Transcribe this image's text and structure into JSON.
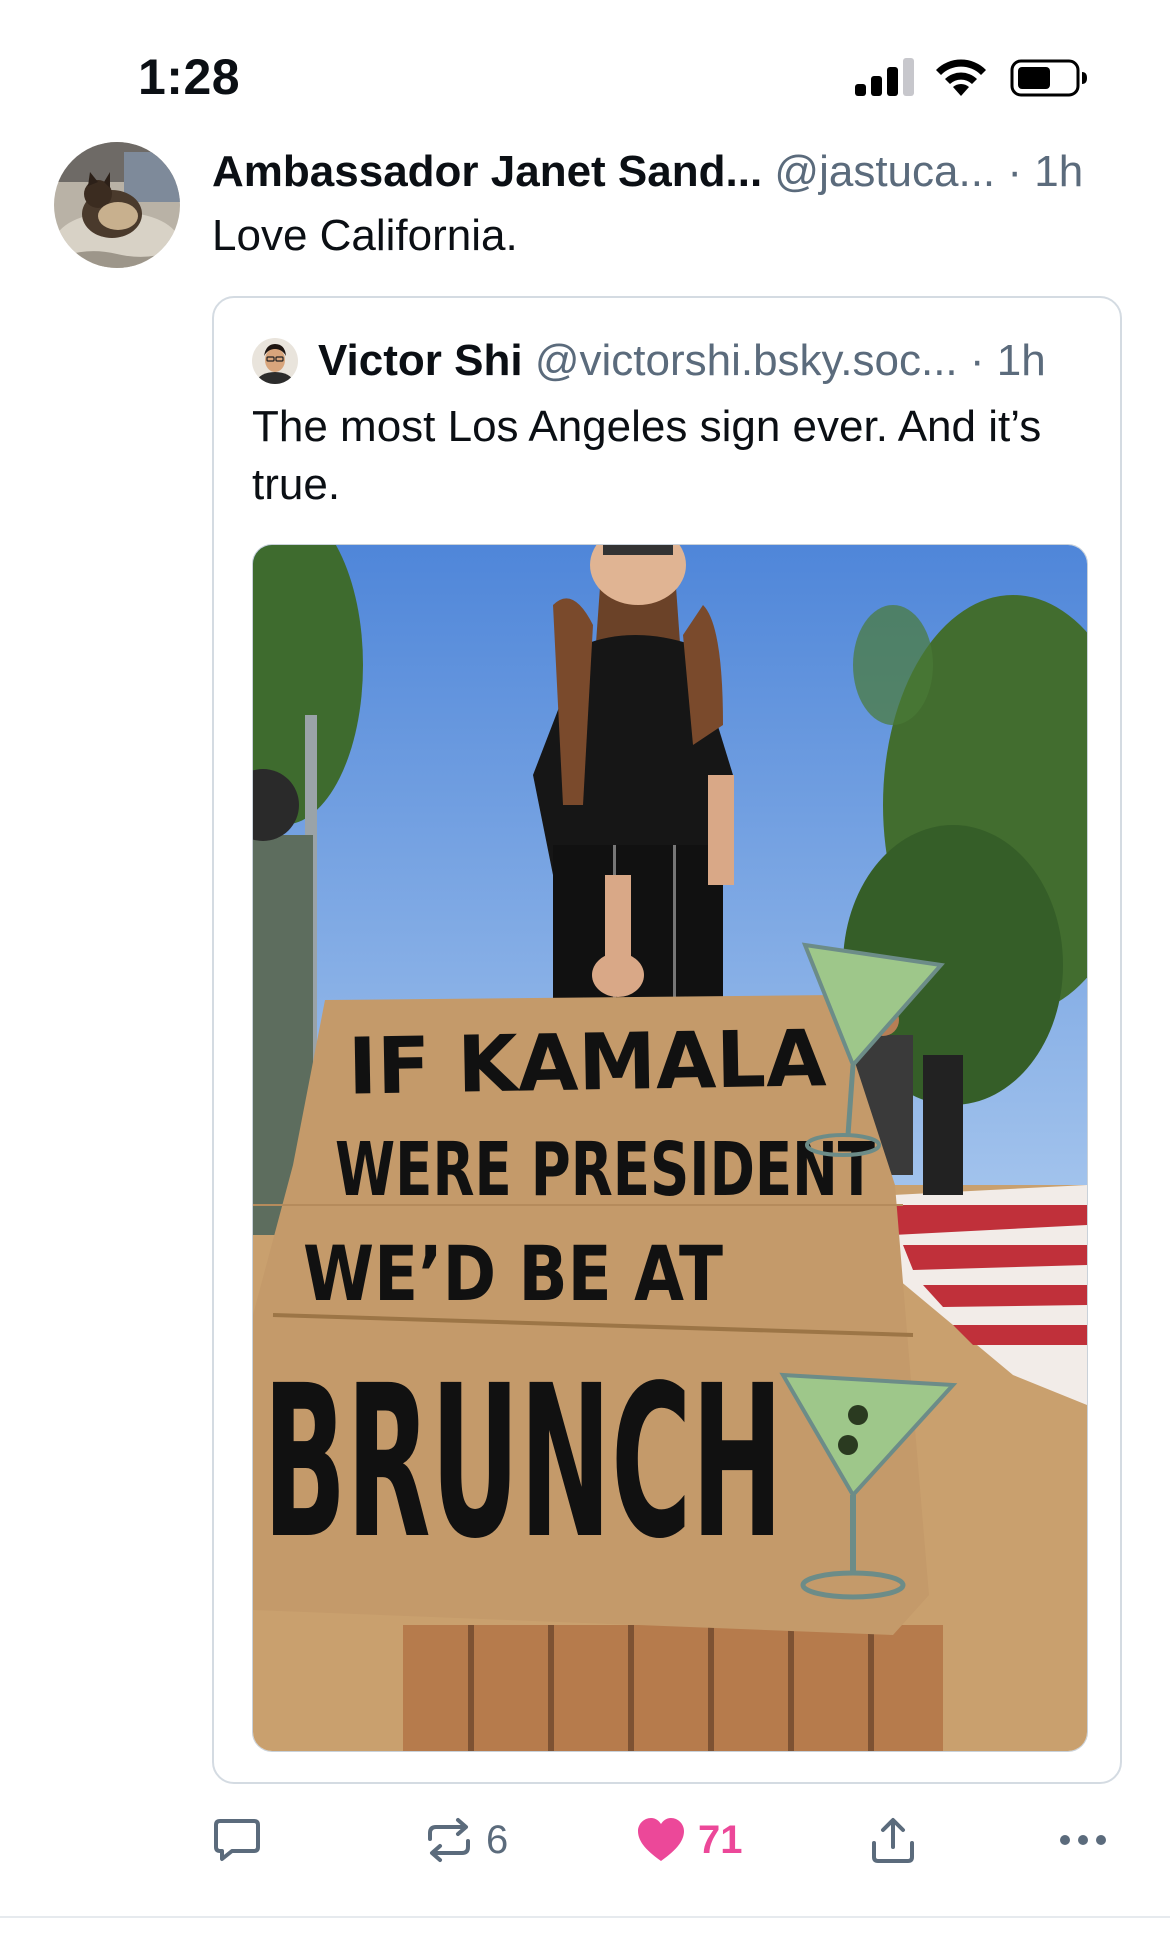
{
  "status_bar": {
    "time": "1:28"
  },
  "post": {
    "author_name": "Ambassador Janet Sand...",
    "author_handle": "@jastuca...",
    "separator": " · ",
    "time": "1h",
    "text": "Love California.",
    "avatar_icon": "cat-avatar-icon"
  },
  "quote": {
    "author_name": "Victor Shi",
    "author_handle": "@victorshi.bsky.soc...",
    "separator": " · ",
    "time": "1h",
    "text": "The most Los Angeles sign ever. And it’s true.",
    "image_sign_lines": [
      "IF KAMALA",
      "WERE PRESIDENT",
      "WE’D BE AT",
      "BRUNCH"
    ]
  },
  "actions": {
    "reply_icon": "reply-icon",
    "repost_icon": "repost-icon",
    "repost_count": "6",
    "like_icon": "heart-icon",
    "like_count": "71",
    "share_icon": "share-icon",
    "more_icon": "more-icon"
  },
  "colors": {
    "like": "#ec4899",
    "muted": "#5b6b7c",
    "border": "#d4dbe2"
  }
}
